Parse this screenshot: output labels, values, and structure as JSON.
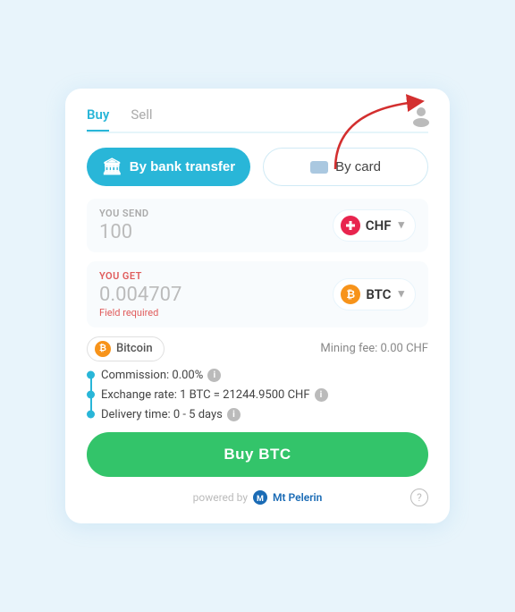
{
  "tabs": {
    "buy": "Buy",
    "sell": "Sell"
  },
  "active_tab": "buy",
  "payment": {
    "bank_transfer": "By bank transfer",
    "by_card": "By card"
  },
  "send": {
    "label": "YOU SEND",
    "amount": "100",
    "currency": "CHF"
  },
  "receive": {
    "label": "YOU GET",
    "amount": "0.004707",
    "currency": "BTC",
    "field_required": "Field required"
  },
  "coin": {
    "name": "Bitcoin",
    "mining_fee": "Mining fee: 0.00 CHF"
  },
  "info": {
    "commission": "Commission: 0.00%",
    "exchange_rate": "Exchange rate: 1 BTC = 21244.9500 CHF",
    "delivery_time": "Delivery time: 0 - 5 days"
  },
  "buy_button": "Buy BTC",
  "footer": {
    "powered_by": "powered by",
    "brand": "Mt Pelerin"
  },
  "icons": {
    "profile": "👤",
    "bank": "🏛",
    "card": "💳",
    "info": "i",
    "help": "?",
    "btc": "₿",
    "chevron": "▾"
  }
}
